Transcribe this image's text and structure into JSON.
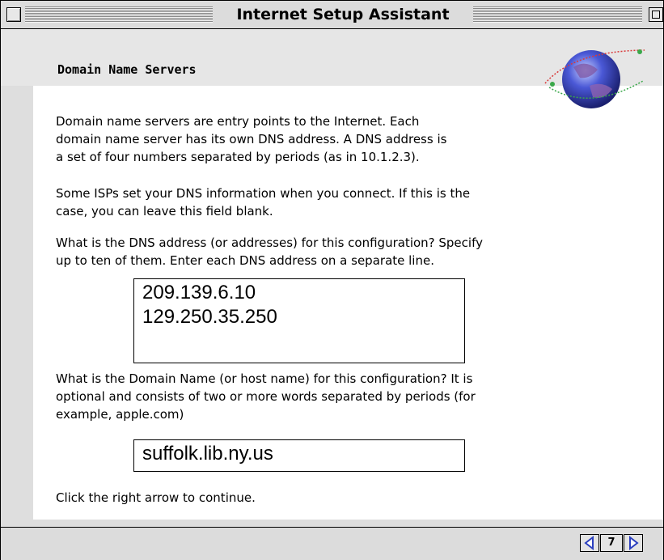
{
  "window": {
    "title": "Internet Setup Assistant"
  },
  "header": {
    "section_title": "Domain Name Servers"
  },
  "content": {
    "intro_lines": [
      "Domain name servers are entry points to the Internet.  Each",
      "domain name server has its own DNS address. A DNS address is",
      "a set of four numbers separated by periods (as in 10.1.2.3)."
    ],
    "isp_lines": [
      "Some ISPs set your DNS information when you connect.  If this is the",
      "case, you can leave this field blank."
    ],
    "dns_question_lines": [
      "What is the DNS address (or addresses) for this configuration?  Specify",
      "up to ten of them.  Enter each DNS address on a separate line."
    ],
    "dns_addresses": "209.139.6.10\n129.250.35.250",
    "domain_question_lines": [
      "What is the Domain Name (or host name) for this configuration?  It is",
      "optional and consists of two or more words separated by periods (for",
      "example, apple.com)"
    ],
    "domain_name": "suffolk.lib.ny.us",
    "continue_text": "Click the right arrow to continue."
  },
  "footer": {
    "page_number": "7",
    "prev_icon": "left-arrow-icon",
    "next_icon": "right-arrow-icon"
  },
  "colors": {
    "arrow_blue": "#2b3fbf",
    "globe_blue": "#3a4cc4"
  }
}
